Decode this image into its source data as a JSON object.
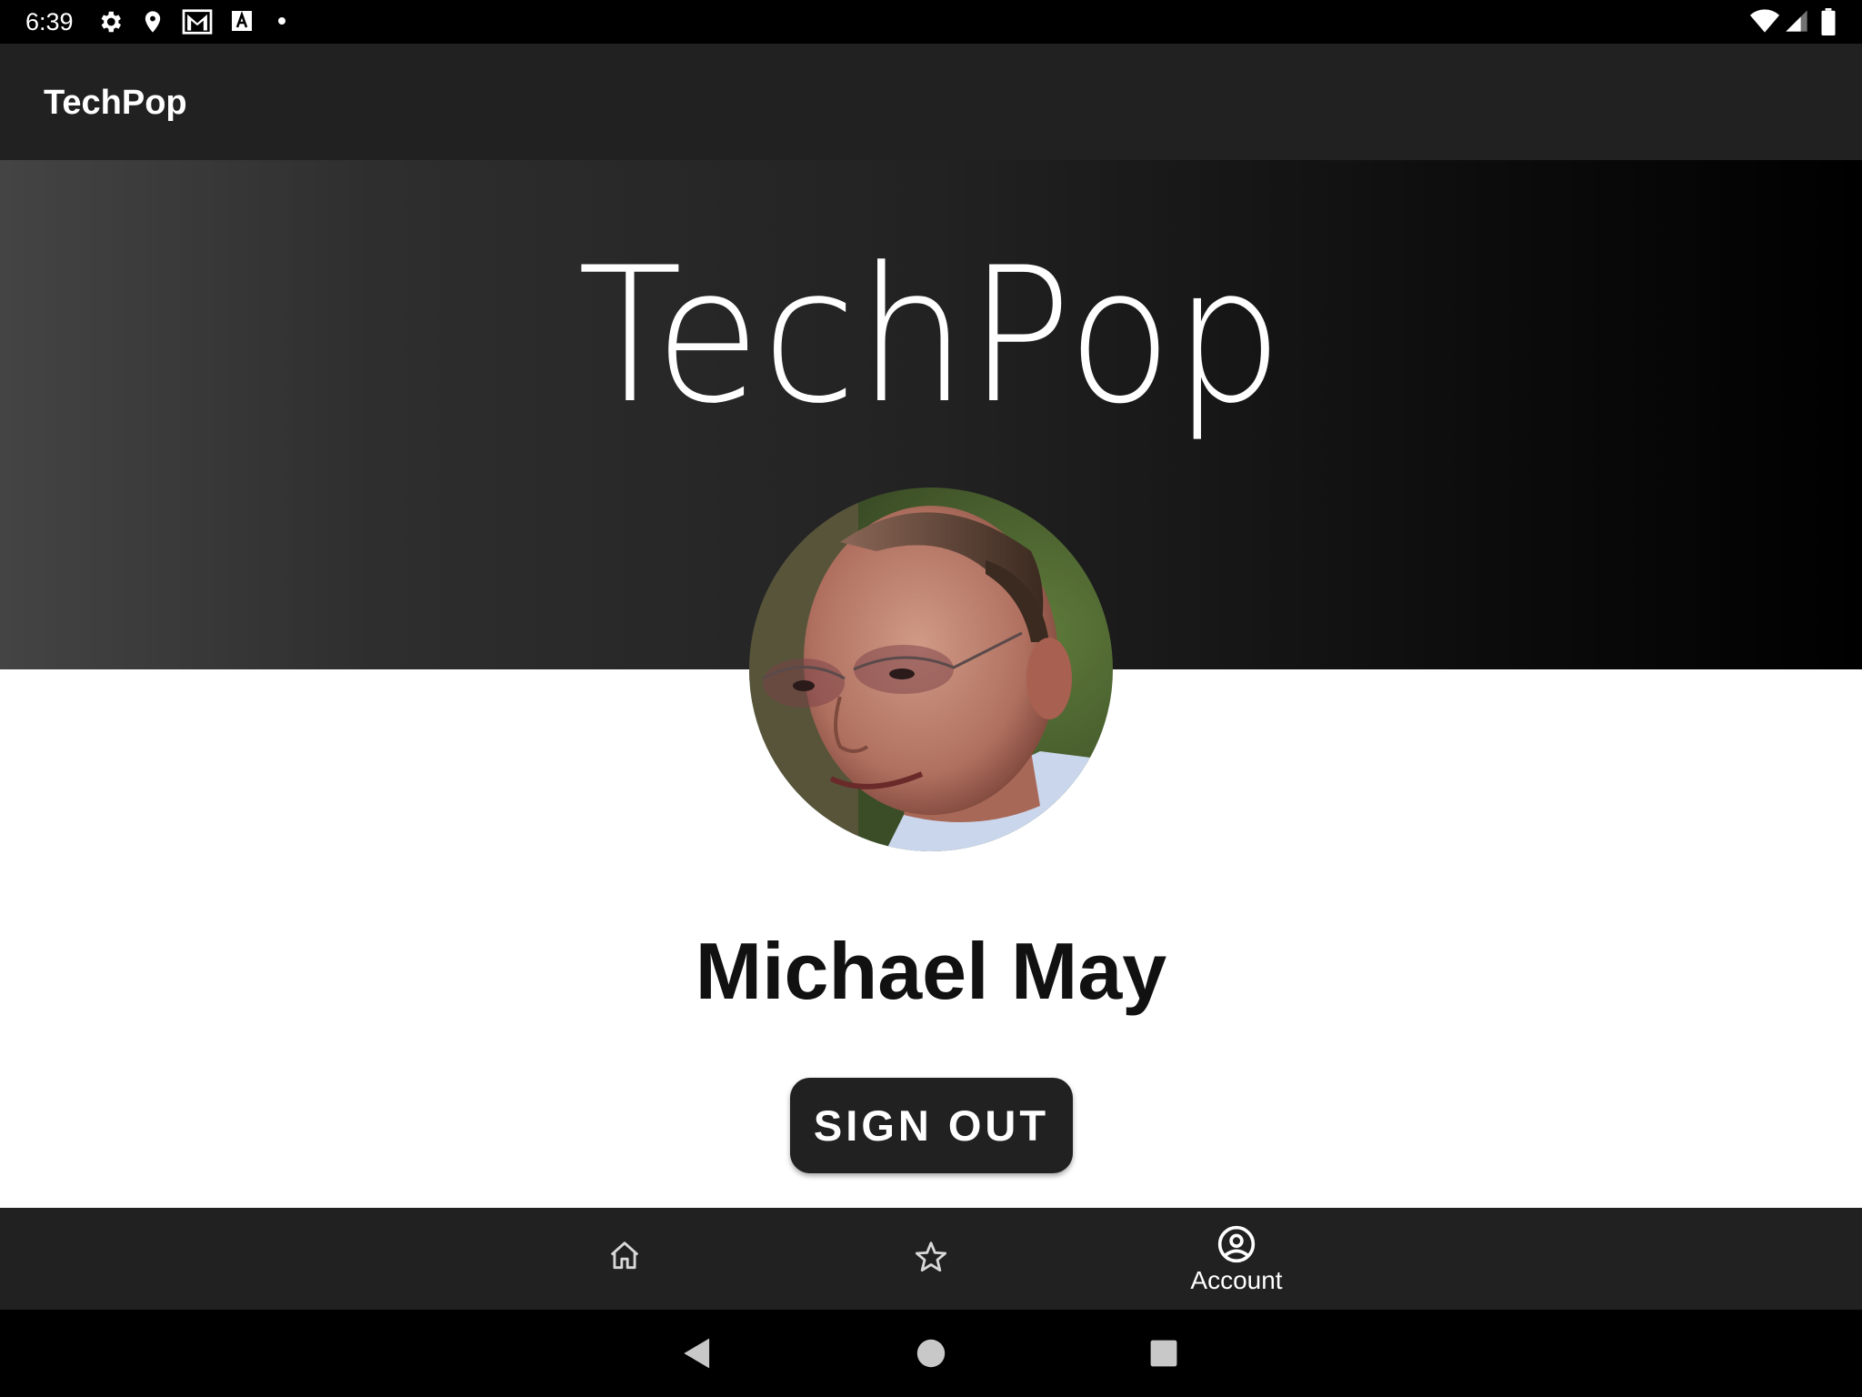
{
  "status_bar": {
    "time": "6:39",
    "left_icons": [
      "gear-icon",
      "location-pin-icon",
      "gmail-icon",
      "font-a-icon",
      "dot-icon"
    ],
    "right_icons": [
      "wifi-icon",
      "cell-signal-icon",
      "battery-icon"
    ]
  },
  "app_bar": {
    "title": "TechPop"
  },
  "hero": {
    "title": "TechPop"
  },
  "profile": {
    "name": "Michael May",
    "sign_out_label": "SIGN OUT"
  },
  "bottom_nav": {
    "items": [
      {
        "id": "home",
        "icon": "home-icon",
        "label": "",
        "selected": false
      },
      {
        "id": "favorites",
        "icon": "star-icon",
        "label": "",
        "selected": false
      },
      {
        "id": "account",
        "icon": "account-circle-icon",
        "label": "Account",
        "selected": true
      }
    ]
  },
  "system_nav": {
    "buttons": [
      "back-icon",
      "home-circle-icon",
      "recents-icon"
    ]
  },
  "colors": {
    "app_bar": "#212121",
    "status_bar": "#000000",
    "button": "#212121",
    "background": "#ffffff"
  }
}
